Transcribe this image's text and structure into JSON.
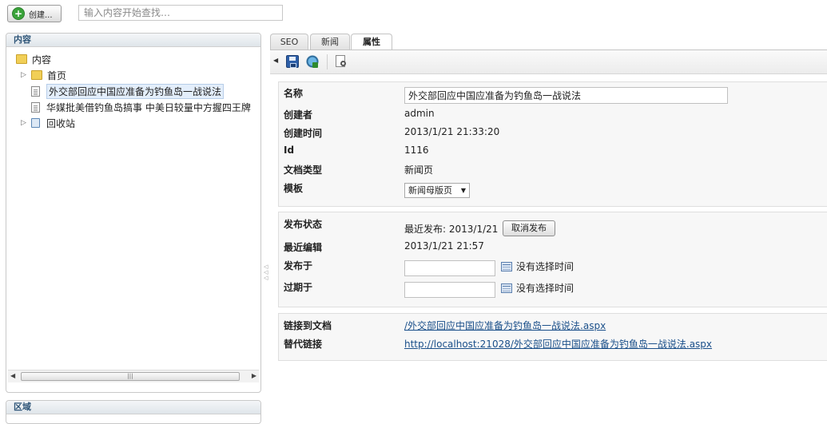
{
  "toolbar": {
    "create_label": "创建...",
    "search_placeholder": "输入内容开始查找…"
  },
  "tree_panel": {
    "title": "内容",
    "items": [
      {
        "label": "内容",
        "icon": "folder-icon"
      },
      {
        "label": "首页",
        "icon": "folder-icon"
      },
      {
        "label": "外交部回应中国应准备为钓鱼岛一战说法",
        "icon": "document-icon",
        "selected": true
      },
      {
        "label": "华媒批美借钓鱼岛搞事 中美日较量中方握四王牌",
        "icon": "document-icon"
      },
      {
        "label": "回收站",
        "icon": "recycle-bin-icon"
      }
    ]
  },
  "region_panel": {
    "title": "区域"
  },
  "tabs": [
    {
      "label": "SEO"
    },
    {
      "label": "新闻"
    },
    {
      "label": "属性",
      "active": true
    }
  ],
  "properties": {
    "name_label": "名称",
    "name_value": "外交部回应中国应准备为钓鱼岛一战说法",
    "creator_label": "创建者",
    "creator_value": "admin",
    "created_label": "创建时间",
    "created_value": "2013/1/21 21:33:20",
    "id_label": "Id",
    "id_value": "1116",
    "doctype_label": "文档类型",
    "doctype_value": "新闻页",
    "template_label": "模板",
    "template_value": "新闻母版页"
  },
  "publishing": {
    "status_label": "发布状态",
    "status_value": "最近发布: 2013/1/21",
    "unpublish_label": "取消发布",
    "last_edit_label": "最近编辑",
    "last_edit_value": "2013/1/21 21:57",
    "publish_at_label": "发布于",
    "publish_at_value": "",
    "publish_at_note": "没有选择时间",
    "expire_at_label": "过期于",
    "expire_at_value": "",
    "expire_at_note": "没有选择时间"
  },
  "links": {
    "doc_link_label": "链接到文档",
    "doc_link_value": "/外交部回应中国应准备为钓鱼岛一战说法.aspx",
    "alt_link_label": "替代链接",
    "alt_link_value": "http://localhost:21028/外交部回应中国应准备为钓鱼岛一战说法.aspx"
  }
}
